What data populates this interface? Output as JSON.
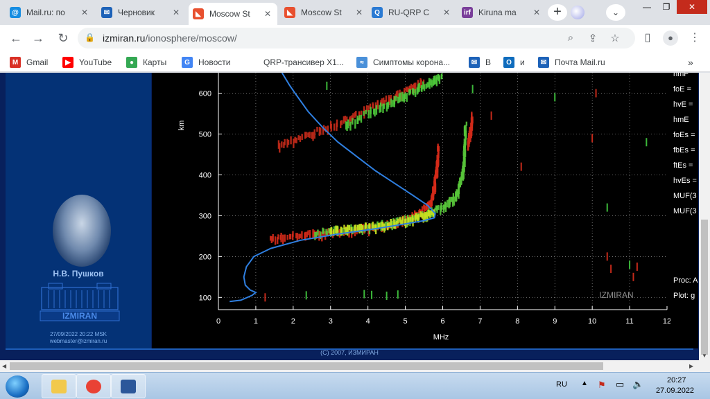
{
  "tabs": [
    {
      "label": "Mail.ru: по",
      "icon": "mailru-at-icon",
      "color": "#168de2",
      "glyph": "@"
    },
    {
      "label": "Черновик",
      "icon": "mail-envelope-icon",
      "color": "#1d62b8",
      "glyph": "✉"
    },
    {
      "label": "Moscow St",
      "icon": "izmiran-icon",
      "color": "#e8502f",
      "glyph": "◣"
    },
    {
      "label": "Moscow St",
      "icon": "izmiran-icon",
      "color": "#e8502f",
      "glyph": "◣"
    },
    {
      "label": "RU-QRP C",
      "icon": "ruqrp-icon",
      "color": "#2a7ad3",
      "glyph": "Q"
    },
    {
      "label": "Kiruna ma",
      "icon": "kiruna-irf-icon",
      "color": "#7a3f9a",
      "glyph": "irf"
    }
  ],
  "address": {
    "host": "izmiran.ru",
    "path": "/ionosphere/moscow/"
  },
  "bookmarks": [
    {
      "label": "Gmail",
      "icon": "gmail-icon",
      "color": "#d93025",
      "glyph": "M"
    },
    {
      "label": "YouTube",
      "icon": "youtube-icon",
      "color": "#ff0000",
      "glyph": "▶"
    },
    {
      "label": "Карты",
      "icon": "maps-pin-icon",
      "color": "#34a853",
      "glyph": "●"
    },
    {
      "label": "Новости",
      "icon": "news-icon",
      "color": "#4285f4",
      "glyph": "G"
    },
    {
      "label": "QRP-трансивер Х1...",
      "icon": "blank-page-icon",
      "color": "#ffffff",
      "glyph": ""
    },
    {
      "label": "Симптомы корона...",
      "icon": "radio-icon",
      "color": "#4a90d9",
      "glyph": "≈"
    },
    {
      "label": "В",
      "icon": "mail-envelope-icon",
      "color": "#1d62b8",
      "glyph": "✉"
    },
    {
      "label": "и",
      "icon": "outlook-icon",
      "color": "#0f6cbd",
      "glyph": "O"
    },
    {
      "label": "Почта Mail.ru",
      "icon": "mail-envelope-icon",
      "color": "#1d62b8",
      "glyph": "✉"
    }
  ],
  "sidebar": {
    "name": "Н.В. Пушков",
    "logo_text": "IZMIRAN",
    "datetime": "27/09/2022 20:22 MSK",
    "email": "webmaster@izmiran.ru"
  },
  "copyright": "(C) 2007, ИЗМИРАН",
  "params": [
    "hmF",
    "foE =",
    "hvE =",
    "hmE",
    "foEs =",
    "fbEs =",
    "ftEs =",
    "hvEs =",
    "MUF(3",
    "MUF(3",
    "Proc: A",
    "Plot: g"
  ],
  "chart_data": {
    "type": "scatter",
    "xlabel": "MHz",
    "ylabel": "km",
    "xlim": [
      0,
      12
    ],
    "ylim": [
      70,
      650
    ],
    "xticks": [
      0,
      1,
      2,
      3,
      4,
      5,
      6,
      7,
      8,
      9,
      10,
      11,
      12
    ],
    "yticks": [
      100,
      200,
      300,
      400,
      500,
      600
    ],
    "grid": true,
    "watermark": "IZMIRAN",
    "series": [
      {
        "style": "line",
        "color": "#2f7fe0",
        "points": [
          [
            0.3,
            90
          ],
          [
            0.6,
            93
          ],
          [
            0.9,
            105
          ],
          [
            1.0,
            112
          ],
          [
            0.85,
            118
          ],
          [
            0.72,
            130
          ],
          [
            0.68,
            150
          ],
          [
            0.75,
            175
          ],
          [
            0.95,
            200
          ],
          [
            1.4,
            220
          ],
          [
            2.2,
            240
          ],
          [
            3.2,
            255
          ],
          [
            4.2,
            268
          ],
          [
            5.0,
            280
          ],
          [
            5.5,
            288
          ],
          [
            5.78,
            295
          ],
          [
            5.8,
            305
          ],
          [
            5.6,
            325
          ],
          [
            5.2,
            350
          ],
          [
            4.7,
            380
          ],
          [
            4.2,
            410
          ],
          [
            3.7,
            445
          ],
          [
            3.2,
            480
          ],
          [
            2.8,
            515
          ],
          [
            2.4,
            555
          ],
          [
            2.05,
            600
          ],
          [
            1.9,
            620
          ],
          [
            1.7,
            650
          ]
        ]
      }
    ],
    "echo_traces": [
      {
        "color": "#d42a1a",
        "points": [
          [
            1.4,
            238
          ],
          [
            2.2,
            248
          ],
          [
            3.0,
            255
          ],
          [
            3.8,
            262
          ],
          [
            4.5,
            272
          ],
          [
            5.0,
            285
          ],
          [
            5.4,
            302
          ],
          [
            5.7,
            330
          ],
          [
            5.8,
            370
          ],
          [
            5.85,
            410
          ],
          [
            5.9,
            470
          ]
        ]
      },
      {
        "color": "#58c43a",
        "points": [
          [
            2.6,
            252
          ],
          [
            3.4,
            262
          ],
          [
            4.2,
            270
          ],
          [
            5.0,
            285
          ],
          [
            5.6,
            300
          ],
          [
            6.1,
            320
          ],
          [
            6.4,
            350
          ],
          [
            6.55,
            400
          ],
          [
            6.6,
            460
          ],
          [
            6.62,
            520
          ]
        ]
      },
      {
        "color": "#c8e020",
        "points": [
          [
            3.0,
            258
          ],
          [
            3.8,
            266
          ],
          [
            4.6,
            275
          ],
          [
            5.3,
            290
          ],
          [
            5.8,
            305
          ]
        ]
      },
      {
        "color": "#c42a1a",
        "points": [
          [
            1.6,
            468
          ],
          [
            2.5,
            495
          ],
          [
            3.4,
            530
          ],
          [
            4.2,
            565
          ],
          [
            5.0,
            600
          ],
          [
            5.5,
            625
          ]
        ]
      },
      {
        "color": "#4cc83a",
        "points": [
          [
            3.4,
            515
          ],
          [
            4.3,
            560
          ],
          [
            5.0,
            590
          ],
          [
            5.6,
            618
          ],
          [
            6.0,
            640
          ]
        ]
      },
      {
        "color": "#d02a1a",
        "points": [
          [
            6.7,
            470
          ],
          [
            6.75,
            500
          ],
          [
            6.8,
            540
          ]
        ]
      }
    ],
    "sparse_points": [
      {
        "color": "#c42a1a",
        "points": [
          [
            1.25,
            100
          ],
          [
            8.1,
            420
          ],
          [
            7.3,
            545
          ],
          [
            10.1,
            600
          ],
          [
            10.0,
            490
          ],
          [
            10.5,
            170
          ],
          [
            10.4,
            200
          ],
          [
            11.1,
            150
          ],
          [
            11.2,
            175
          ]
        ]
      },
      {
        "color": "#3cb83a",
        "points": [
          [
            2.35,
            105
          ],
          [
            3.9,
            108
          ],
          [
            4.1,
            106
          ],
          [
            4.5,
            104
          ],
          [
            4.8,
            107
          ],
          [
            10.4,
            320
          ],
          [
            11.45,
            480
          ],
          [
            11.0,
            180
          ],
          [
            6.8,
            610
          ],
          [
            2.9,
            618
          ],
          [
            9.0,
            590
          ]
        ]
      }
    ]
  },
  "taskbar": {
    "apps": [
      {
        "icon": "file-explorer-icon",
        "color": "#f2c94c"
      },
      {
        "icon": "chrome-icon",
        "color": "#e94235"
      },
      {
        "icon": "word-icon",
        "color": "#2b579a"
      }
    ],
    "lang": "RU",
    "time": "20:27",
    "date": "27.09.2022"
  }
}
